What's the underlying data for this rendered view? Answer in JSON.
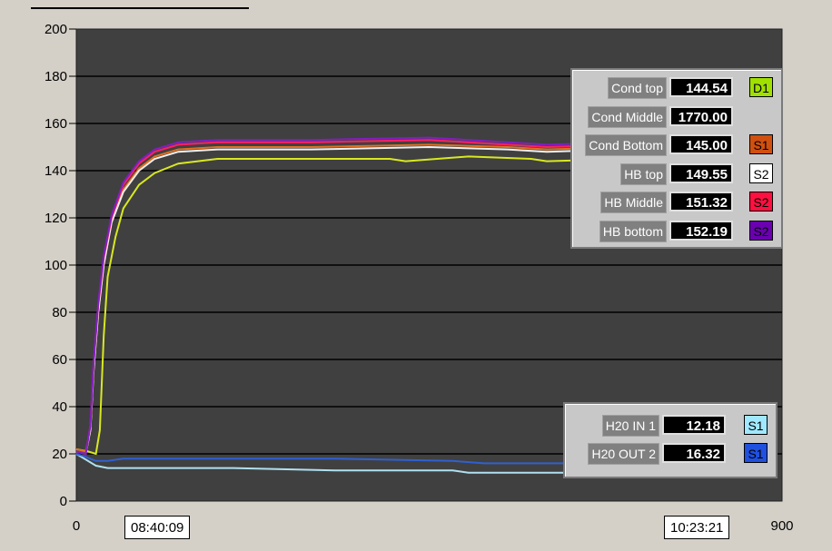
{
  "chart_data": {
    "type": "line",
    "xlim": [
      0,
      900
    ],
    "ylim": [
      0,
      200
    ],
    "yticks": [
      "0",
      "20",
      "40",
      "60",
      "80",
      "100",
      "120",
      "140",
      "160",
      "180",
      "200"
    ],
    "xtick_labels": {
      "start": "0",
      "end": "900"
    },
    "grid": "horizontal",
    "start_time": "08:40:09",
    "end_time": "10:23:21",
    "plot_background": "#404040",
    "series": [
      {
        "name": "Cond top",
        "value": "144.54",
        "swatch": "D1",
        "swatch_color": "#a0e000",
        "swatch_text_color": "#000000",
        "color": "#d8e820",
        "points": [
          [
            0,
            22
          ],
          [
            15,
            21
          ],
          [
            25,
            20
          ],
          [
            30,
            30
          ],
          [
            35,
            70
          ],
          [
            40,
            95
          ],
          [
            50,
            112
          ],
          [
            60,
            124
          ],
          [
            80,
            134
          ],
          [
            100,
            139
          ],
          [
            130,
            143
          ],
          [
            180,
            145
          ],
          [
            300,
            145
          ],
          [
            400,
            145
          ],
          [
            420,
            144
          ],
          [
            500,
            146
          ],
          [
            580,
            145
          ],
          [
            600,
            144
          ],
          [
            700,
            145
          ]
        ]
      },
      {
        "name": "Cond Middle",
        "value": "1770.00",
        "swatch": "",
        "swatch_color": "",
        "swatch_text_color": "",
        "color": "#000000",
        "points": []
      },
      {
        "name": "Cond Bottom",
        "value": "145.00",
        "swatch": "S1",
        "swatch_color": "#d05010",
        "swatch_text_color": "#000000",
        "color": "#e07020",
        "points": [
          [
            0,
            22
          ],
          [
            12,
            21
          ],
          [
            18,
            30
          ],
          [
            22,
            55
          ],
          [
            28,
            80
          ],
          [
            35,
            100
          ],
          [
            45,
            118
          ],
          [
            60,
            132
          ],
          [
            80,
            141
          ],
          [
            100,
            146
          ],
          [
            130,
            149
          ],
          [
            180,
            150
          ],
          [
            300,
            150
          ],
          [
            450,
            151
          ],
          [
            550,
            150
          ],
          [
            600,
            149
          ],
          [
            700,
            150
          ]
        ]
      },
      {
        "name": "HB top",
        "value": "149.55",
        "swatch": "S2",
        "swatch_color": "#ffffff",
        "swatch_text_color": "#000000",
        "color": "#f0f0f0",
        "points": [
          [
            0,
            21
          ],
          [
            12,
            20
          ],
          [
            18,
            30
          ],
          [
            22,
            55
          ],
          [
            28,
            80
          ],
          [
            35,
            100
          ],
          [
            45,
            118
          ],
          [
            60,
            131
          ],
          [
            80,
            140
          ],
          [
            100,
            145
          ],
          [
            130,
            148
          ],
          [
            180,
            149
          ],
          [
            300,
            149
          ],
          [
            450,
            150
          ],
          [
            550,
            149
          ],
          [
            600,
            148
          ],
          [
            700,
            149
          ]
        ]
      },
      {
        "name": "HB Middle",
        "value": "151.32",
        "swatch": "S2",
        "swatch_color": "#ff1040",
        "swatch_text_color": "#000000",
        "color": "#ff2060",
        "points": [
          [
            0,
            21
          ],
          [
            12,
            20
          ],
          [
            18,
            32
          ],
          [
            22,
            58
          ],
          [
            28,
            83
          ],
          [
            35,
            103
          ],
          [
            45,
            120
          ],
          [
            60,
            134
          ],
          [
            80,
            143
          ],
          [
            100,
            148
          ],
          [
            130,
            151
          ],
          [
            180,
            152
          ],
          [
            300,
            152
          ],
          [
            450,
            153
          ],
          [
            550,
            151
          ],
          [
            600,
            150
          ],
          [
            700,
            151
          ]
        ]
      },
      {
        "name": "HB bottom",
        "value": "152.19",
        "swatch": "S2",
        "swatch_color": "#6a00b0",
        "swatch_text_color": "#000000",
        "color": "#8020c0",
        "points": [
          [
            0,
            21
          ],
          [
            12,
            20
          ],
          [
            18,
            32
          ],
          [
            22,
            58
          ],
          [
            28,
            84
          ],
          [
            35,
            104
          ],
          [
            45,
            121
          ],
          [
            60,
            135
          ],
          [
            80,
            144
          ],
          [
            100,
            149
          ],
          [
            130,
            152
          ],
          [
            180,
            153
          ],
          [
            300,
            153
          ],
          [
            450,
            154
          ],
          [
            550,
            152
          ],
          [
            600,
            151
          ],
          [
            700,
            152
          ]
        ]
      }
    ],
    "water_series": [
      {
        "name": "H20 IN 1",
        "value": "12.18",
        "swatch": "S1",
        "swatch_color": "#a0e8ff",
        "swatch_text_color": "#000000",
        "color": "#b0e0f0",
        "points": [
          [
            0,
            20
          ],
          [
            10,
            18
          ],
          [
            25,
            15
          ],
          [
            40,
            14
          ],
          [
            100,
            14
          ],
          [
            200,
            14
          ],
          [
            330,
            13
          ],
          [
            400,
            13
          ],
          [
            480,
            13
          ],
          [
            500,
            12
          ],
          [
            700,
            12
          ]
        ]
      },
      {
        "name": "H20 OUT 2",
        "value": "16.32",
        "swatch": "S1",
        "swatch_color": "#2050e0",
        "swatch_text_color": "#000000",
        "color": "#3060d0",
        "points": [
          [
            0,
            20
          ],
          [
            10,
            19
          ],
          [
            25,
            17
          ],
          [
            40,
            17
          ],
          [
            60,
            18
          ],
          [
            100,
            18
          ],
          [
            200,
            18
          ],
          [
            330,
            18
          ],
          [
            480,
            17
          ],
          [
            520,
            16
          ],
          [
            700,
            16
          ]
        ]
      }
    ]
  }
}
